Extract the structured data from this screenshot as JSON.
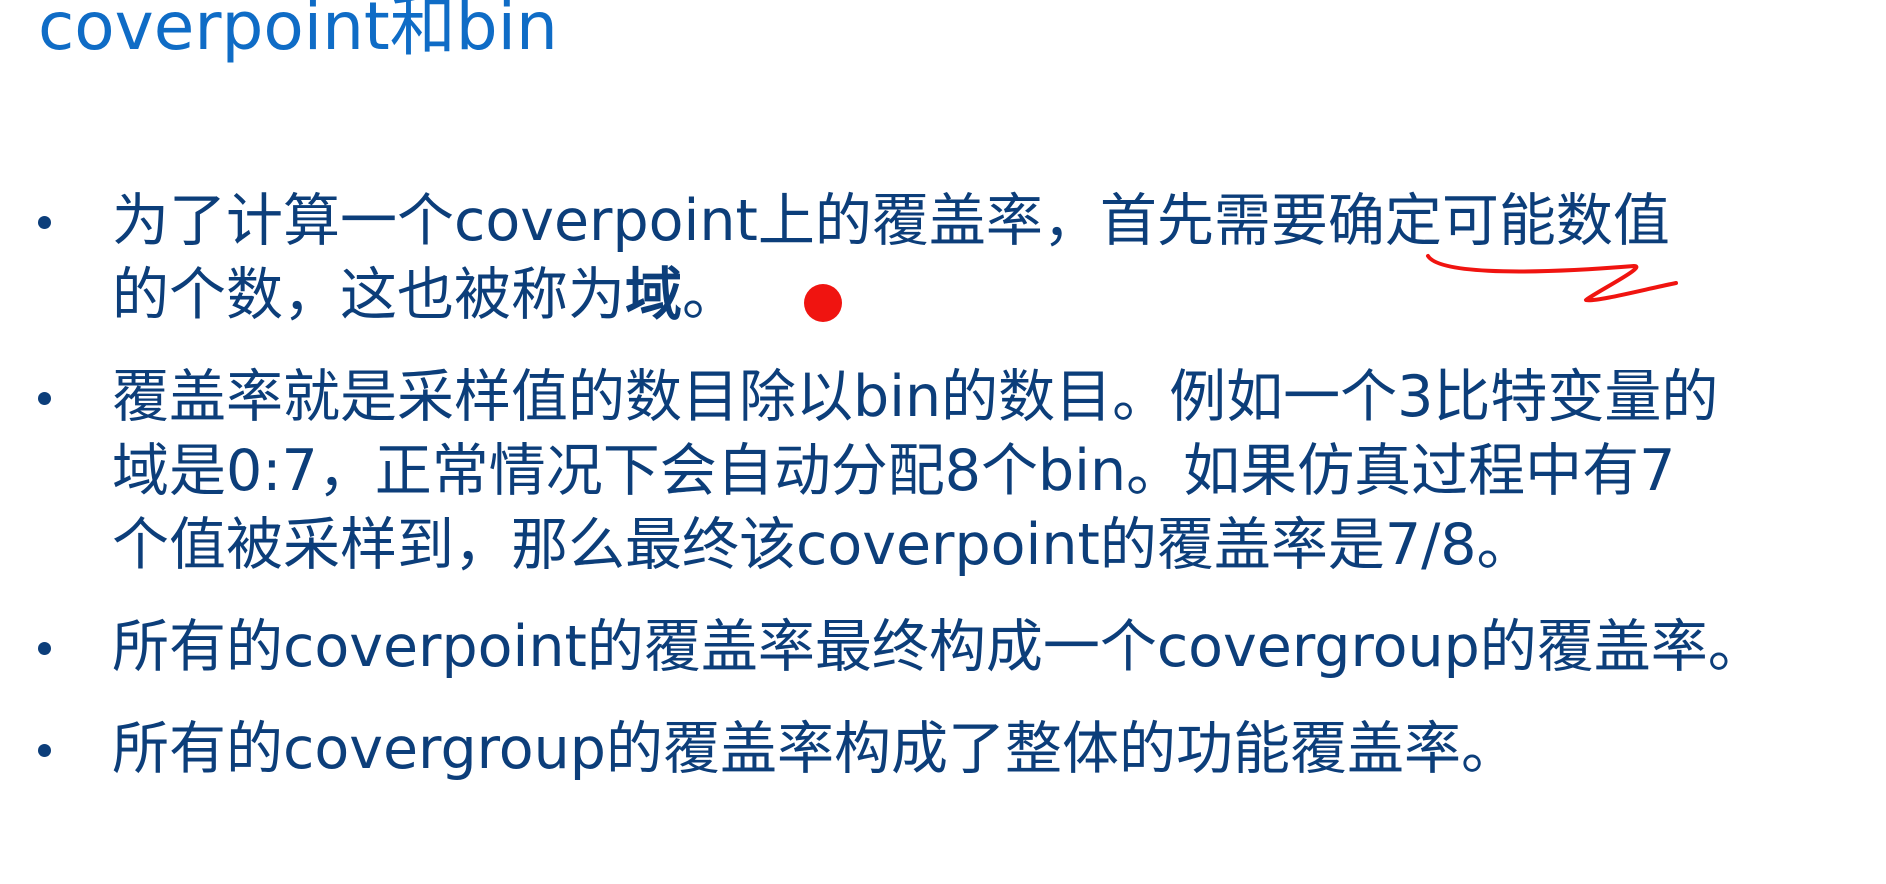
{
  "slide": {
    "title": "coverpoint和bin",
    "bullets": [
      {
        "lines": [
          {
            "text": "为了计算一个coverpoint上的覆盖率，首先需要确定可能数值"
          },
          {
            "text": "的个数，这也被称为",
            "bold": "域",
            "after": "。"
          }
        ]
      },
      {
        "lines": [
          {
            "text": "覆盖率就是采样值的数目除以bin的数目。例如一个3比特变量的"
          },
          {
            "text": "域是0:7，正常情况下会自动分配8个bin。如果仿真过程中有7"
          },
          {
            "text": "个值被采样到，那么最终该coverpoint的覆盖率是7/8。"
          }
        ]
      },
      {
        "lines": [
          {
            "text": "所有的coverpoint的覆盖率最终构成一个covergroup的覆盖率。"
          }
        ]
      },
      {
        "lines": [
          {
            "text": "所有的covergroup的覆盖率构成了整体的功能覆盖率。"
          }
        ]
      }
    ]
  },
  "annotations": {
    "pen_color": "#f01410",
    "pointer_color": "#f01410"
  }
}
